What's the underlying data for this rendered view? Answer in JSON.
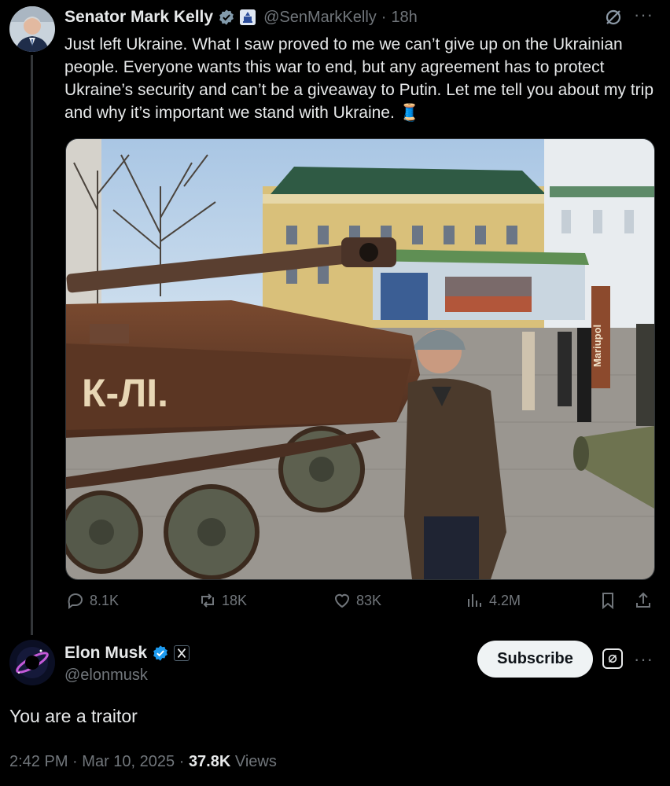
{
  "tweet": {
    "author_name": "Senator Mark Kelly",
    "handle": "@SenMarkKelly",
    "time": "18h",
    "text": "Just left Ukraine. What I saw proved to me we can’t give up on the Ukrainian people. Everyone wants this war to end, but any agreement has to protect Ukraine’s security and can’t be a giveaway to Putin. Let me tell you about my trip and why it’s important we stand with Ukraine.",
    "thread_emoji": "🧵",
    "image_signs": {
      "tank_graffiti": "К-ЛІ.",
      "mariupol_sign": "Mariupol"
    },
    "stats": {
      "replies": "8.1K",
      "reposts": "18K",
      "likes": "83K",
      "views": "4.2M"
    }
  },
  "reply": {
    "author_name": "Elon Musk",
    "handle": "@elonmusk",
    "subscribe_label": "Subscribe",
    "text": "You are a traitor",
    "time": "2:42 PM",
    "date": "Mar 10, 2025",
    "views_count": "37.8K",
    "views_label": "Views",
    "separator": "·"
  },
  "colors": {
    "background": "#000000",
    "text": "#e7e9ea",
    "muted": "#71767b",
    "verified_blue": "#1d9bf0",
    "divider": "#2f3336"
  },
  "icons": [
    "verified-badge-icon",
    "capitol-badge-icon",
    "grok-icon",
    "more-icon",
    "reply-icon",
    "repost-icon",
    "like-icon",
    "views-icon",
    "bookmark-icon",
    "share-icon",
    "x-logo-icon"
  ]
}
